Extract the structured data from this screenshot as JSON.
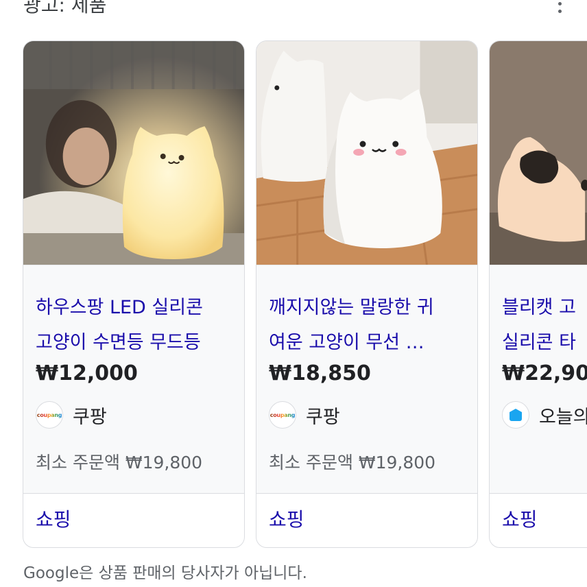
{
  "header": {
    "title": "광고: 제품"
  },
  "products": [
    {
      "title_line1": "하우스팡 LED 실리콘",
      "title_line2": "고양이 수면등 무드등",
      "price": "₩12,000",
      "merchant": "쿠팡",
      "merchant_logo_text": "coupang",
      "min_order": "최소 주문액 ₩19,800",
      "link": "쇼핑"
    },
    {
      "title_line1": "깨지지않는 말랑한 귀",
      "title_line2": "여운 고양이 무선 …",
      "price": "₩18,850",
      "merchant": "쿠팡",
      "merchant_logo_text": "coupang",
      "min_order": "최소 주문액 ₩19,800",
      "link": "쇼핑"
    },
    {
      "title_line1": "블리캣 고",
      "title_line2": "실리콘 타",
      "price": "₩22,90",
      "merchant": "오늘의",
      "link": "쇼핑"
    }
  ],
  "footer": {
    "disclaimer": "Google은 상품 판매의 당사자가 아닙니다."
  },
  "colors": {
    "link": "#1a0dab",
    "border": "#dadce0",
    "info_bg": "#f8f9fa",
    "muted": "#5f6368"
  }
}
